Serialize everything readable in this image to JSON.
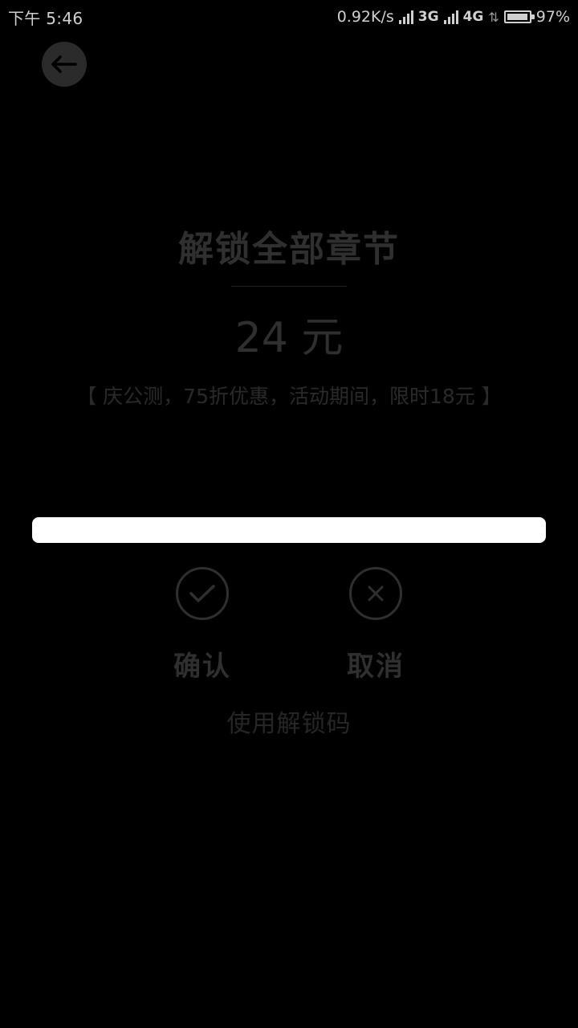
{
  "status_bar": {
    "time": "下午 5:46",
    "net_speed": "0.92K/s",
    "network_1": "3G",
    "network_2": "4G",
    "battery_percent_text": "97%",
    "battery_level": 0.97
  },
  "header": {
    "back_icon": "arrow-left-icon"
  },
  "content": {
    "title": "解锁全部章节",
    "price": "24 元",
    "promo": "【 庆公测，75折优惠，活动期间，限时18元 】"
  },
  "unlock_input": {
    "value": "",
    "placeholder": ""
  },
  "actions": {
    "confirm_label": "确认",
    "confirm_icon": "check-icon",
    "cancel_label": "取消",
    "cancel_icon": "close-icon"
  },
  "unlock_code_link": "使用解锁码",
  "colors": {
    "background": "#000000",
    "muted_text": "#2f2f2f",
    "input_bg": "#ffffff"
  }
}
